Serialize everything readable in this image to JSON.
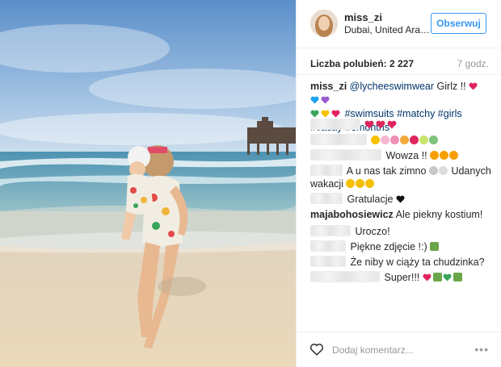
{
  "post": {
    "username": "miss_zi",
    "location": "Dubai, United Ara…",
    "follow_label": "Obserwuj",
    "likes_label": "Liczba polubień: 2 227",
    "time_ago": "7 godz.",
    "caption_user": "miss_zi",
    "caption_mention": "@lycheeswimwear",
    "caption_text": "Girlz !!",
    "caption_tags": "#swimsuits #matchy #girls",
    "caption_tags2": "#vacay #6months"
  },
  "comments": [
    {
      "user_hidden": true,
      "text": ""
    },
    {
      "user_hidden": true,
      "text": ""
    },
    {
      "user_hidden": true,
      "text": "Wowza !!"
    },
    {
      "user_hidden": true,
      "text": "A u nas tak zimno"
    },
    {
      "user_hidden": true,
      "text": "Udanych"
    },
    {
      "user_hidden": false,
      "text": "wakacji"
    },
    {
      "user_hidden": true,
      "text": "Gratulacje"
    },
    {
      "user": "majabohosiewicz",
      "text": "Ale piekny kostium!"
    },
    {
      "user_hidden": true,
      "text": "Uroczo!"
    },
    {
      "user_hidden": true,
      "text": "Piękne zdjęcie !:)"
    },
    {
      "user_hidden": true,
      "text": "Że niby w ciąży ta chudzinka?"
    },
    {
      "user_hidden": true,
      "text": "Super!!!"
    }
  ],
  "footer": {
    "add_comment_placeholder": "Dodaj komentarz...",
    "more_glyph": "•••"
  },
  "icons": {
    "like": "heart-outline-icon",
    "more": "more-options-icon"
  },
  "colors": {
    "follow": "#3897f0",
    "link": "#003569",
    "muted": "#999999"
  }
}
